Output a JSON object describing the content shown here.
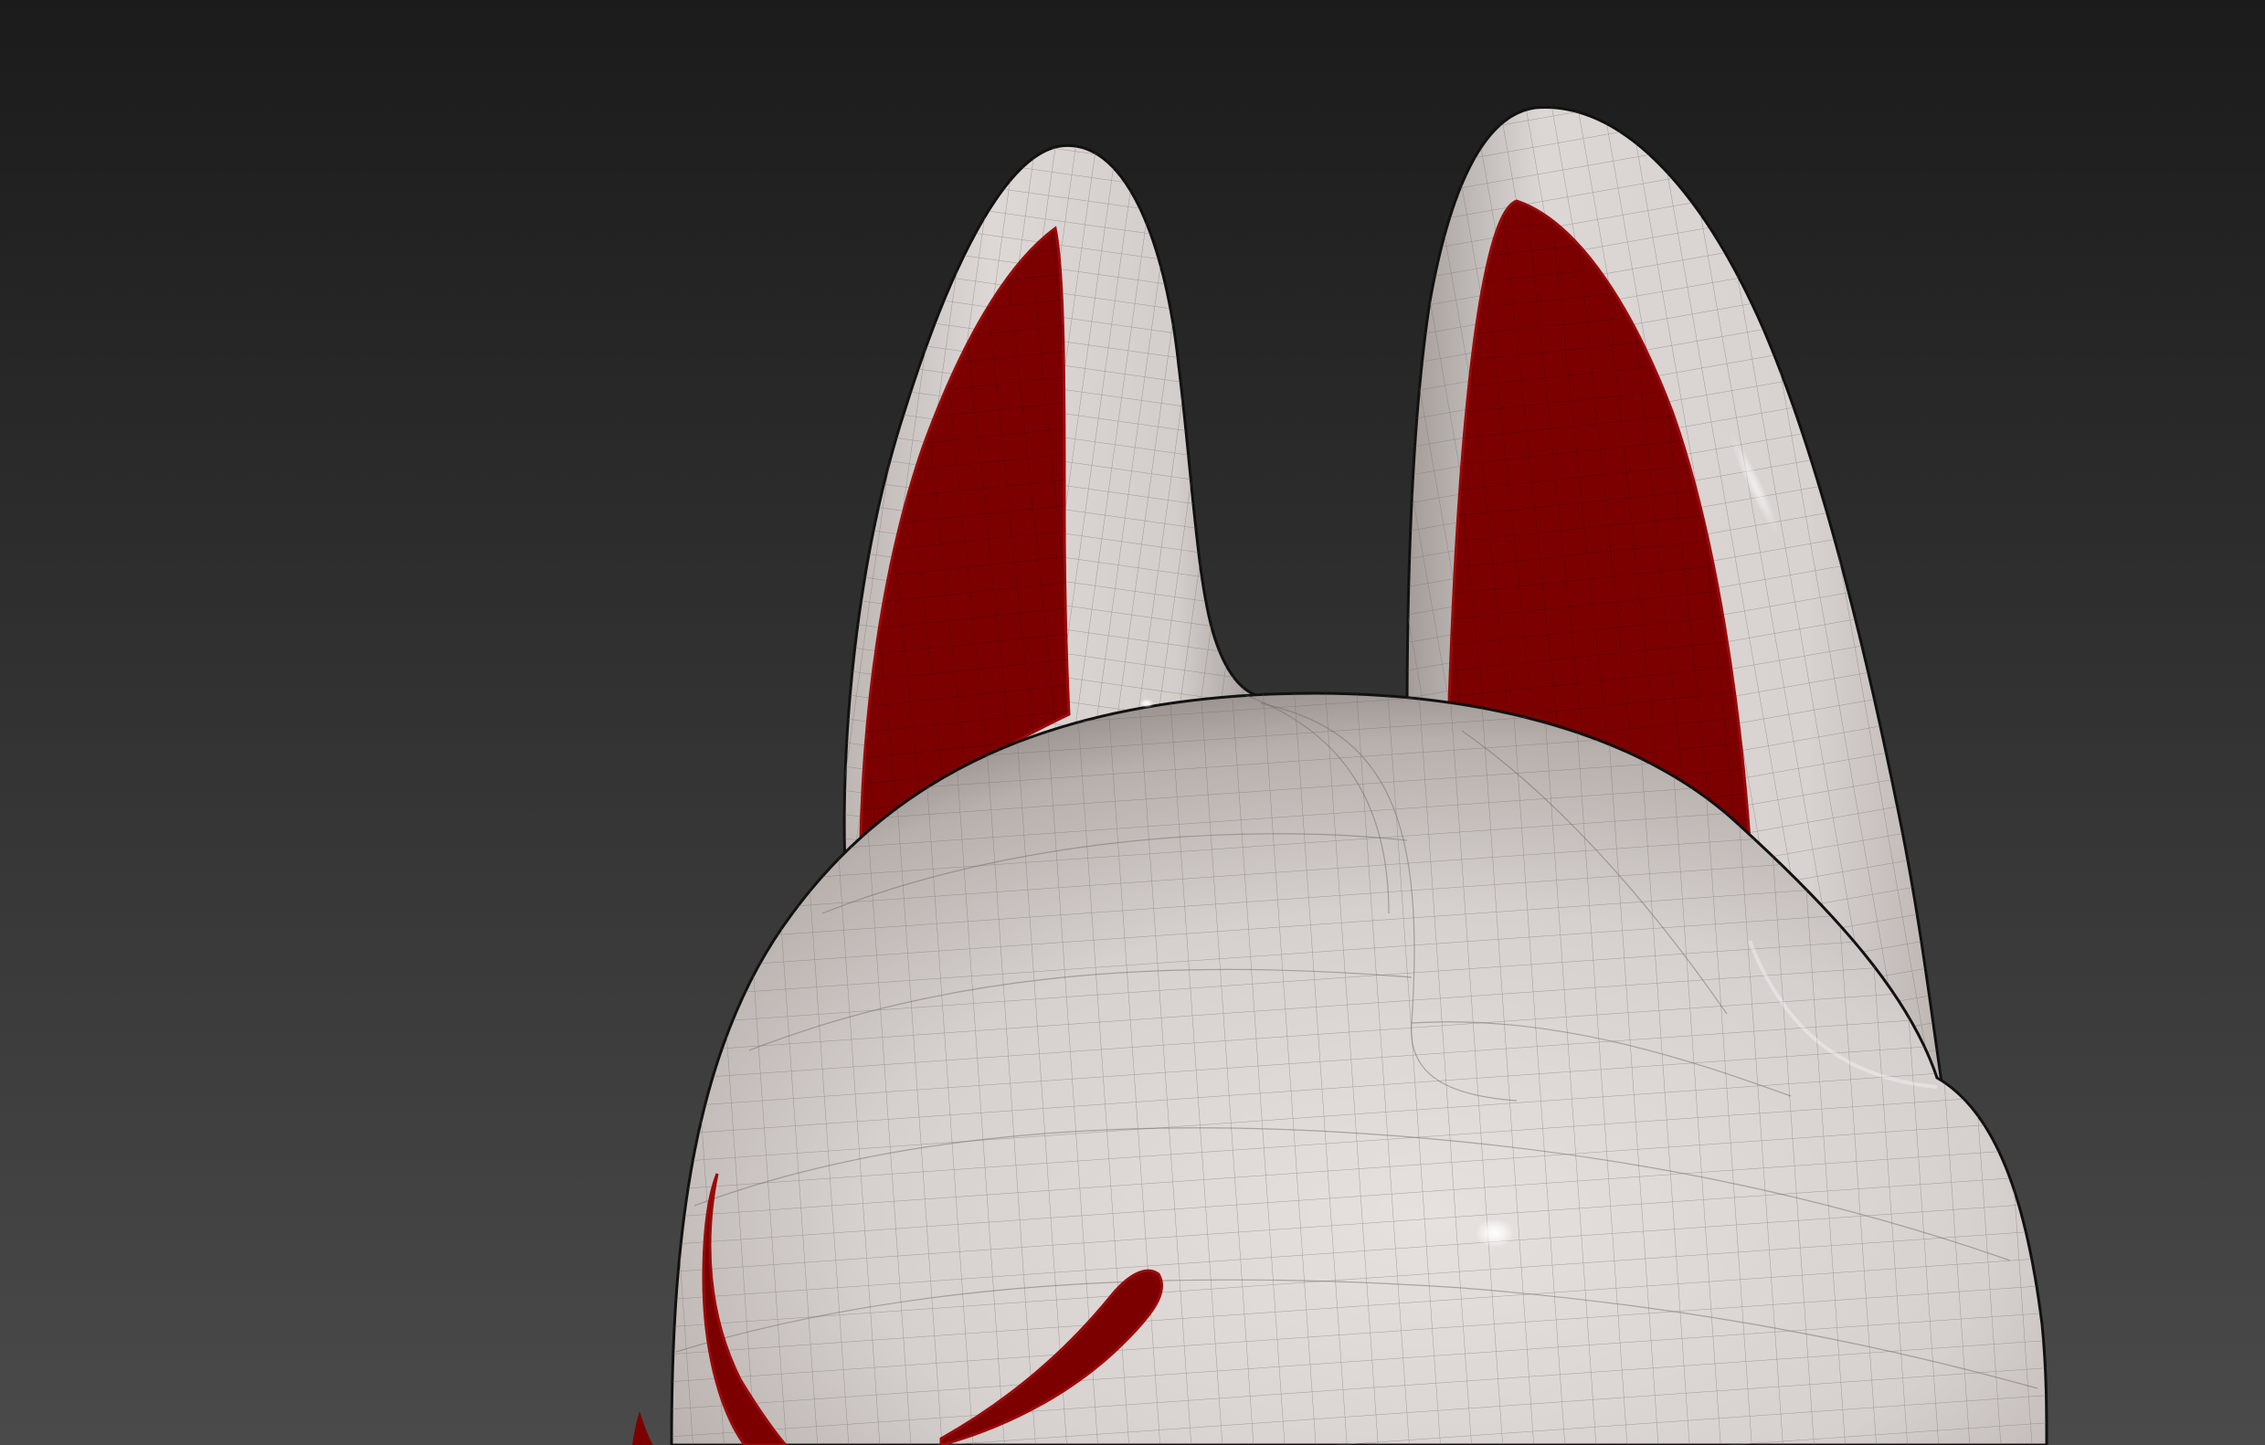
{
  "viewport": {
    "background_top": "#1b1b1b",
    "background_bottom": "#4a4a4a",
    "model": "fox-mask-mesh"
  },
  "model": {
    "surface_color": "#dcd6d4",
    "surface_shadow": "#8f8885",
    "paint_color": "#7d0000",
    "paint_edge": "#9a0a0a",
    "wire_color": "#6f6a68",
    "outline_color": "#111111"
  }
}
